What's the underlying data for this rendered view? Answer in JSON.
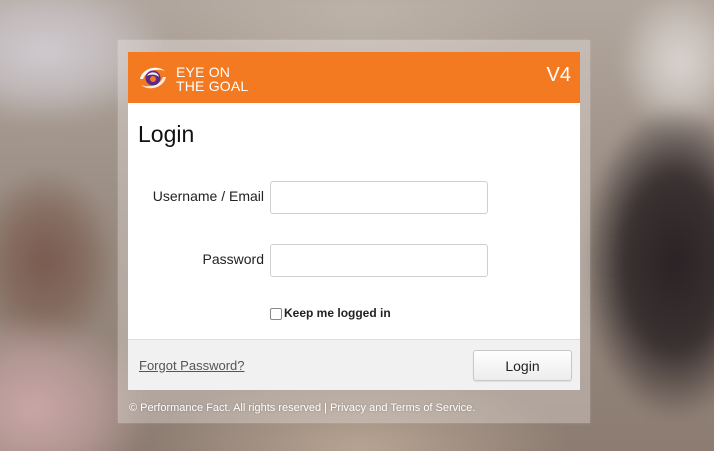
{
  "header": {
    "brand_line1": "EYE ON",
    "brand_line2": "THE GOAL",
    "version": "V4",
    "brand_color": "#f47a21",
    "logo_icon": "eye-swirl-logo"
  },
  "form": {
    "title": "Login",
    "username_label": "Username / Email",
    "username_value": "",
    "username_placeholder": "",
    "password_label": "Password",
    "password_value": "",
    "password_placeholder": "",
    "remember_label": "Keep me logged in",
    "remember_checked": false
  },
  "footer": {
    "forgot_label": "Forgot Password?",
    "login_label": "Login"
  },
  "copyright": {
    "text": "© Performance Fact. All rights reserved",
    "separator": "|",
    "link": "Privacy and Terms of Service."
  }
}
